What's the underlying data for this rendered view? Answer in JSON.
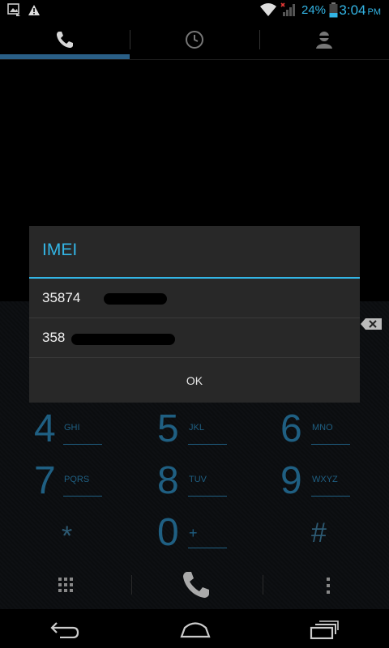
{
  "status_bar": {
    "battery_percent": "24%",
    "time": "3:04",
    "ampm": "PM",
    "icons": [
      "image-notification-icon",
      "warning-icon",
      "wifi-icon",
      "signal-no-service-icon",
      "battery-icon"
    ]
  },
  "tabs": [
    {
      "name": "phone",
      "icon": "phone-icon",
      "selected": true
    },
    {
      "name": "call-log",
      "icon": "clock-icon",
      "selected": false
    },
    {
      "name": "contacts",
      "icon": "person-icon",
      "selected": false
    }
  ],
  "dialog": {
    "title": "IMEI",
    "imei_1": "35874",
    "imei_2": "358",
    "ok_label": "OK"
  },
  "dialpad": {
    "keys": [
      {
        "digit": "4",
        "letters": "GHI"
      },
      {
        "digit": "5",
        "letters": "JKL"
      },
      {
        "digit": "6",
        "letters": "MNO"
      },
      {
        "digit": "7",
        "letters": "PQRS"
      },
      {
        "digit": "8",
        "letters": "TUV"
      },
      {
        "digit": "9",
        "letters": "WXYZ"
      },
      {
        "digit": "*",
        "letters": ""
      },
      {
        "digit": "0",
        "letters": "+"
      },
      {
        "digit": "#",
        "letters": ""
      }
    ]
  },
  "colors": {
    "accent": "#33b5e5",
    "dial_digit": "#1f5f82",
    "dialog_bg": "#282828"
  }
}
